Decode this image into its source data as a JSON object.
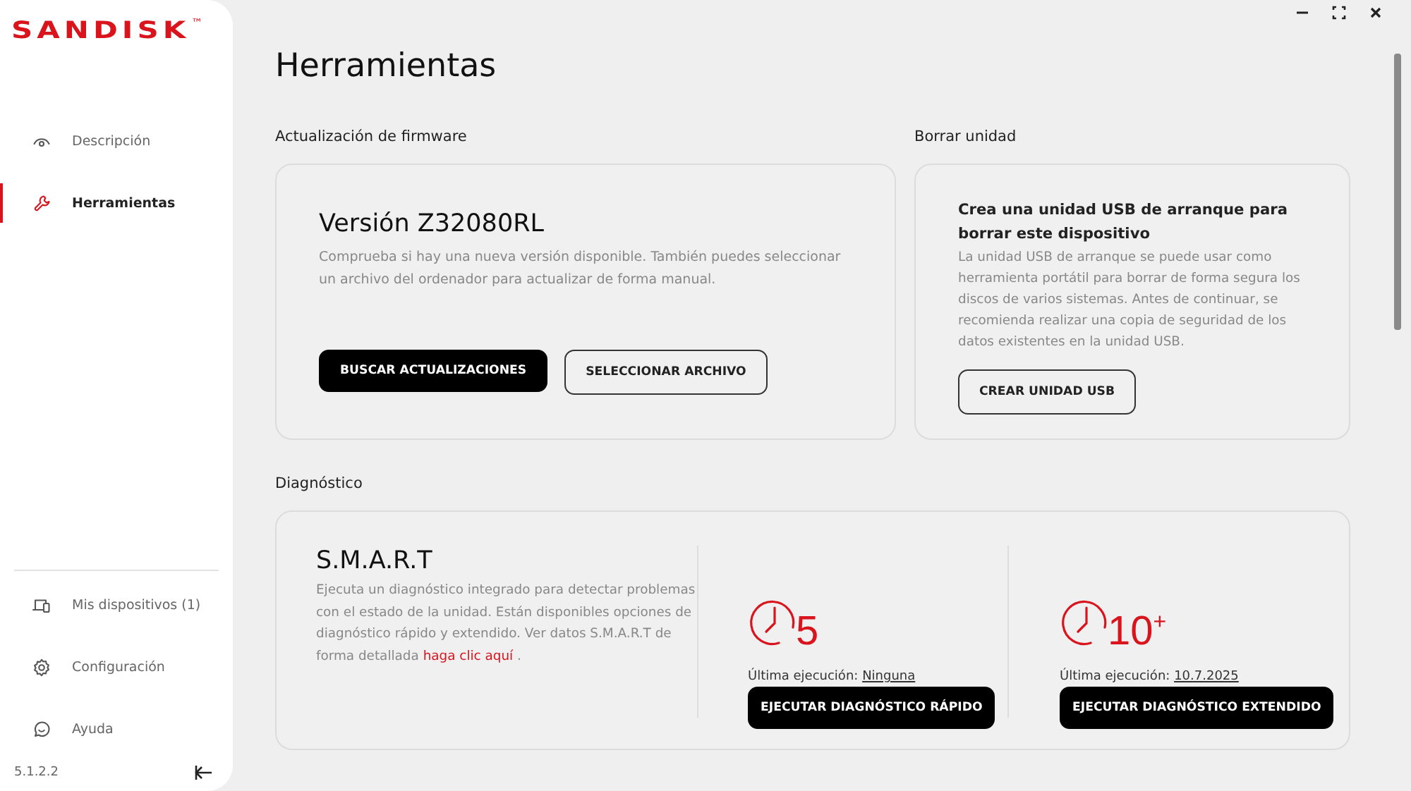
{
  "logo": {
    "text": "SANDISK",
    "trademark": "™"
  },
  "sidebar": {
    "items": [
      {
        "label": "Descripción",
        "selected": false
      },
      {
        "label": "Herramientas",
        "selected": true
      }
    ],
    "bottom_items": [
      {
        "label": "Mis dispositivos (1)"
      },
      {
        "label": "Configuración"
      },
      {
        "label": "Ayuda"
      }
    ],
    "version": "5.1.2.2"
  },
  "page_title": "Herramientas",
  "firmware": {
    "heading": "Actualización de firmware",
    "version": "Versión Z32080RL",
    "description": "Comprueba si hay una nueva versión disponible. También puedes seleccionar un archivo del ordenador para actualizar de forma manual.",
    "buttons": [
      {
        "label": "BUSCAR ACTUALIZACIONES",
        "kind": "primary"
      },
      {
        "label": "SELECCIONAR ARCHIVO",
        "kind": "secondary"
      }
    ]
  },
  "erase": {
    "heading": "Borrar unidad",
    "title": "Crea una unidad USB de arranque para borrar este dispositivo",
    "description": "La unidad USB de arranque se puede usar como herramienta portátil para borrar de forma segura los discos de varios sistemas. Antes de continuar, se recomienda realizar una copia de seguridad de los datos existentes en la unidad USB.",
    "button": "CREAR UNIDAD USB"
  },
  "diagnostics": {
    "heading": "Diagnóstico",
    "title": "S.M.A.R.T",
    "description": "Ejecuta un diagnóstico integrado para detectar problemas con el estado de la unidad. Están disponibles opciones de diagnóstico rápido y extendido. Ver datos S.M.A.R.T de forma detallada ",
    "link": "haga clic aquí",
    "after_link": " .",
    "tests": [
      {
        "minutes": "5",
        "last_run_label": "Última ejecución:",
        "last_run": "Ninguna",
        "button": "EJECUTAR DIAGNÓSTICO RÁPIDO"
      },
      {
        "minutes": "10$^{+}$",
        "last_run_label": "Última ejecución:",
        "last_run": "10.7.2025",
        "button": "EJECUTAR DIAGNÓSTICO EXTENDIDO"
      }
    ]
  }
}
